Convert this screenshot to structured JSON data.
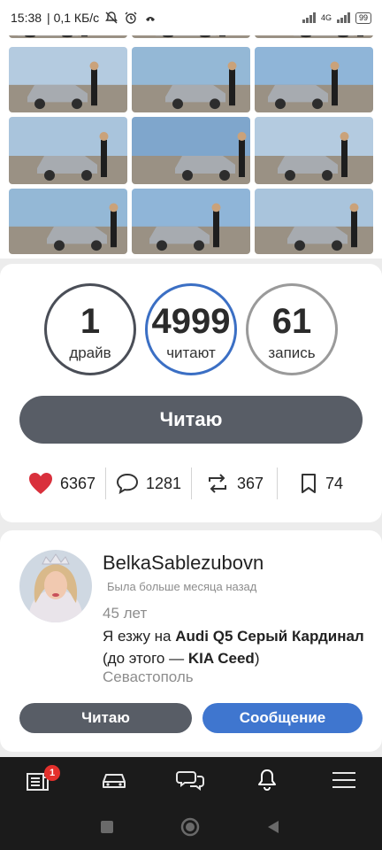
{
  "status_bar": {
    "time": "15:38",
    "speed": "| 0,1 КБ/с",
    "network": "4G",
    "battery": "99"
  },
  "photos": {
    "count": 15
  },
  "stats": {
    "drives": {
      "value": "1",
      "label": "драйв"
    },
    "readers": {
      "value": "4999",
      "label": "читают"
    },
    "posts": {
      "value": "61",
      "label": "запись"
    }
  },
  "follow_button": {
    "label": "Читаю"
  },
  "actions": {
    "likes": "6367",
    "comments": "1281",
    "reposts": "367",
    "bookmarks": "74"
  },
  "profile": {
    "username": "BelkaSablezubovn",
    "last_seen": "Была больше месяца назад",
    "age": "45 лет",
    "drives_prefix": "Я езжу на",
    "car": "Audi Q5 Серый Кардинал",
    "before_prefix": "(до этого —",
    "previous_car": "KIA Ceed",
    "before_suffix": ")",
    "city": "Севастополь",
    "follow_label": "Читаю",
    "message_label": "Сообщение"
  },
  "bottom_nav": {
    "items": [
      "feed-icon",
      "car-icon",
      "chat-icon",
      "bell-icon",
      "menu-icon"
    ],
    "badge": "1"
  },
  "system_nav": {
    "items": [
      "recent-apps-icon",
      "home-icon",
      "back-icon"
    ]
  },
  "colors": {
    "accent": "#3f76cf",
    "dark_button": "#585d66",
    "like": "#d9303c",
    "badge": "#e4302c"
  }
}
